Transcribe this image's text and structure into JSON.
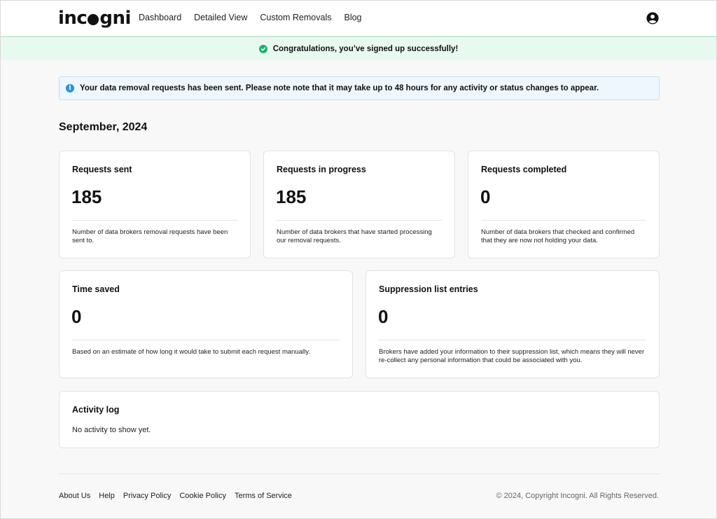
{
  "header": {
    "logo": {
      "pre": "inc",
      "post": "gni"
    },
    "nav": [
      "Dashboard",
      "Detailed View",
      "Custom Removals",
      "Blog"
    ]
  },
  "banner": {
    "message": "Congratulations, you’ve signed up successfully!"
  },
  "info": {
    "message": "Your data removal requests has been sent. Please note note that it may take up to 48 hours for any activity or status changes to appear."
  },
  "period": "September, 2024",
  "stats": {
    "requests_sent": {
      "title": "Requests sent",
      "value": "185",
      "desc": "Number of data brokers removal requests have been sent to."
    },
    "requests_in_progress": {
      "title": "Requests in progress",
      "value": "185",
      "desc": "Number of data brokers that have started processing our removal requests."
    },
    "requests_completed": {
      "title": "Requests completed",
      "value": "0",
      "desc": "Number of data brokers that checked and confirmed that they are now not holding your data."
    },
    "time_saved": {
      "title": "Time saved",
      "value": "0",
      "desc": "Based on an estimate of how long it would take to submit each request manually."
    },
    "suppression": {
      "title": "Suppression list entries",
      "value": "0",
      "desc": "Brokers have added your information to their suppression list, which means they will never re-collect any personal information that could be associated with you."
    }
  },
  "activity": {
    "title": "Activity log",
    "empty": "No activity to show yet."
  },
  "footer": {
    "links": [
      "About Us",
      "Help",
      "Privacy Policy",
      "Cookie Policy",
      "Terms of Service"
    ],
    "copyright": "© 2024, Copyright Incogni. All Rights Reserved."
  },
  "colors": {
    "success": "#1bb36a",
    "info": "#2d8fd6",
    "banner_bg": "#e8f9ef",
    "info_bg": "#eef7fd"
  }
}
